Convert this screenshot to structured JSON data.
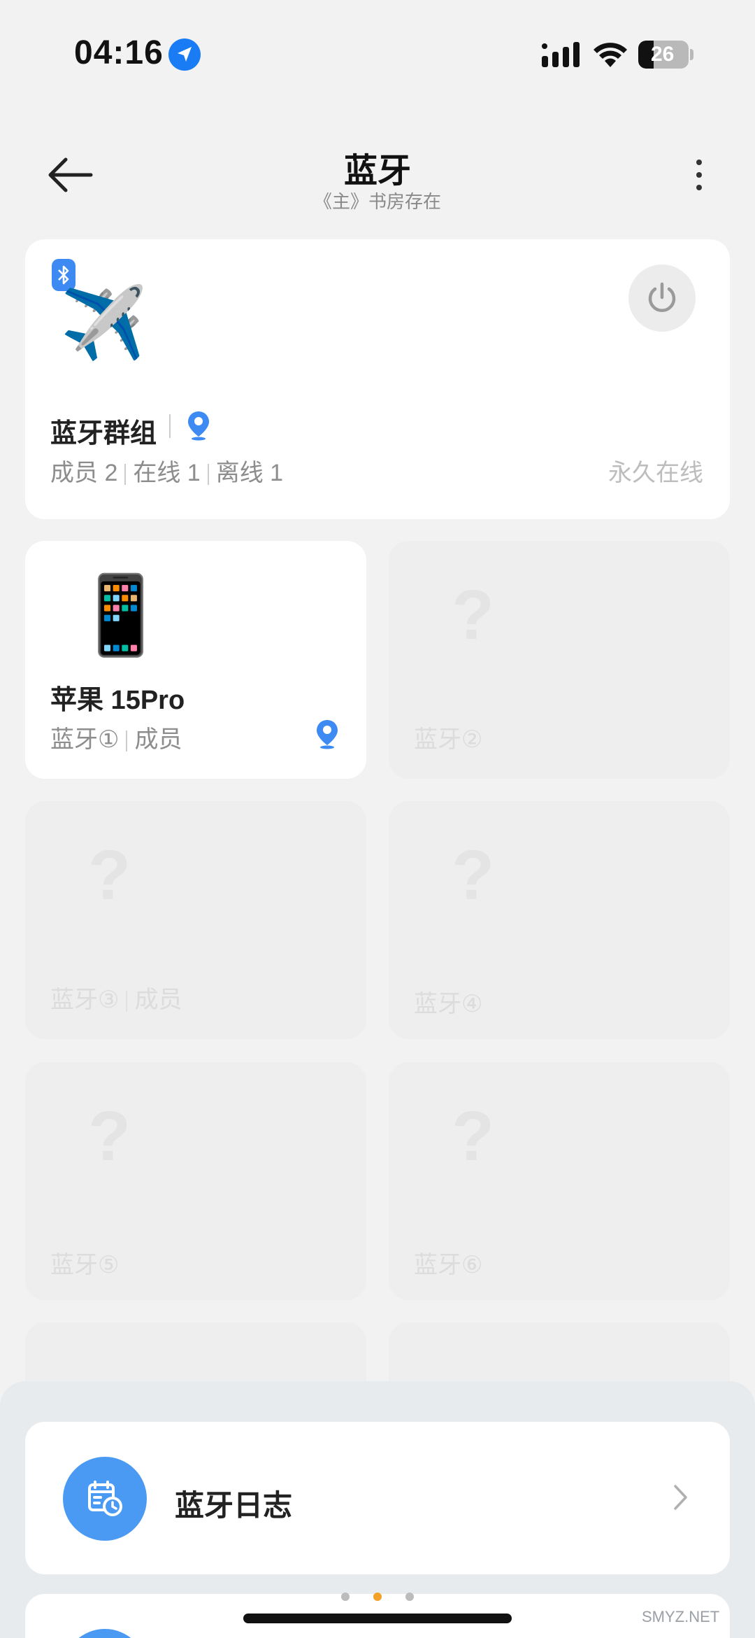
{
  "status_bar": {
    "time": "04:16",
    "battery": "26"
  },
  "header": {
    "title": "蓝牙",
    "subtitle": "《主》书房存在"
  },
  "group": {
    "icon": "✈️",
    "name": "蓝牙群组",
    "members": "成员 2",
    "online": "在线 1",
    "offline": "离线 1",
    "status": "永久在线"
  },
  "devices": [
    {
      "icon": "📱",
      "name": "苹果 15Pro",
      "slot": "蓝牙①",
      "role": "成员",
      "active": true
    },
    {
      "icon": "?",
      "slot": "蓝牙②",
      "active": false
    },
    {
      "icon": "?",
      "slot": "蓝牙③",
      "role": "成员",
      "active": false
    },
    {
      "icon": "?",
      "slot": "蓝牙④",
      "active": false
    },
    {
      "icon": "?",
      "slot": "蓝牙⑤",
      "active": false
    },
    {
      "icon": "?",
      "slot": "蓝牙⑥",
      "active": false
    }
  ],
  "bottom_sheet": {
    "log_title": "蓝牙日志"
  },
  "watermark": "SMYZ.NET",
  "colors": {
    "accent": "#3d8bf2",
    "page_indicator_active": "#f4a12a"
  }
}
